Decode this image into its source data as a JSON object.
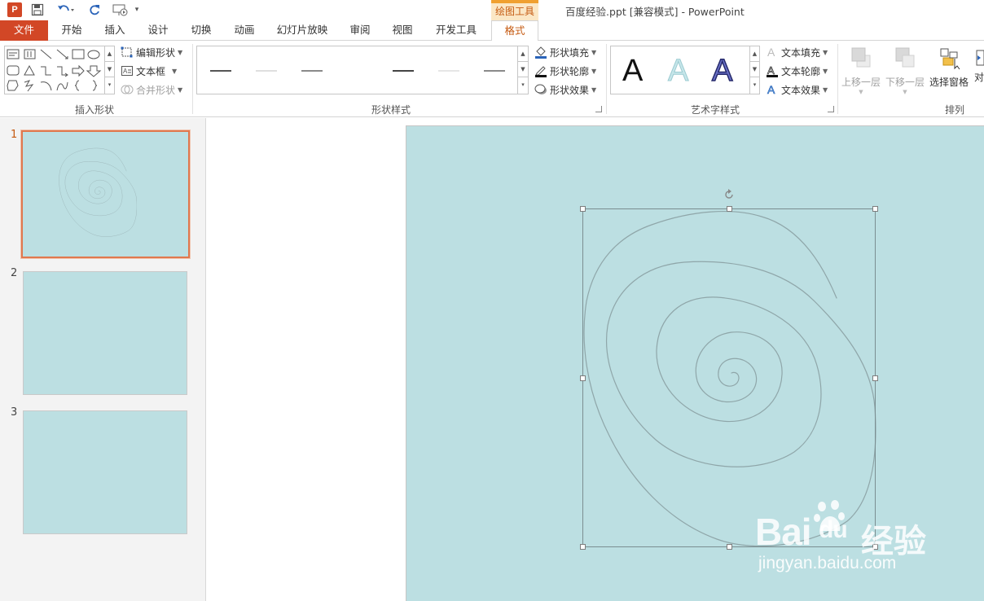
{
  "window": {
    "title": "百度经验.ppt [兼容模式] - PowerPoint",
    "app_logo": "P",
    "contextual_group": "绘图工具"
  },
  "tabs": [
    {
      "label": "文件"
    },
    {
      "label": "开始"
    },
    {
      "label": "插入"
    },
    {
      "label": "设计"
    },
    {
      "label": "切换"
    },
    {
      "label": "动画"
    },
    {
      "label": "幻灯片放映"
    },
    {
      "label": "审阅"
    },
    {
      "label": "视图"
    },
    {
      "label": "开发工具"
    },
    {
      "label": "格式"
    }
  ],
  "ribbon": {
    "insert_shapes": {
      "label": "插入形状",
      "edit_shape": "编辑形状",
      "text_box": "文本框",
      "merge_shapes": "合并形状"
    },
    "shape_styles": {
      "label": "形状样式",
      "fill": "形状填充",
      "outline": "形状轮廓",
      "effects": "形状效果"
    },
    "wordart_styles": {
      "label": "艺术字样式",
      "sample": "A",
      "text_fill": "文本填充",
      "text_outline": "文本轮廓",
      "text_effects": "文本效果"
    },
    "arrange": {
      "label": "排列",
      "bring_forward": "上移一层",
      "send_backward": "下移一层",
      "selection_pane": "选择窗格",
      "align": "对"
    }
  },
  "slides": [
    {
      "number": "1"
    },
    {
      "number": "2"
    },
    {
      "number": "3"
    }
  ],
  "watermark": {
    "brand": "Bai",
    "brand_suffix": "du",
    "product": "经验",
    "url": "jingyan.baidu.com"
  },
  "colors": {
    "accent": "#d24726",
    "slide_bg": "#bcdfe2",
    "spiral": "#8fa6a9"
  }
}
